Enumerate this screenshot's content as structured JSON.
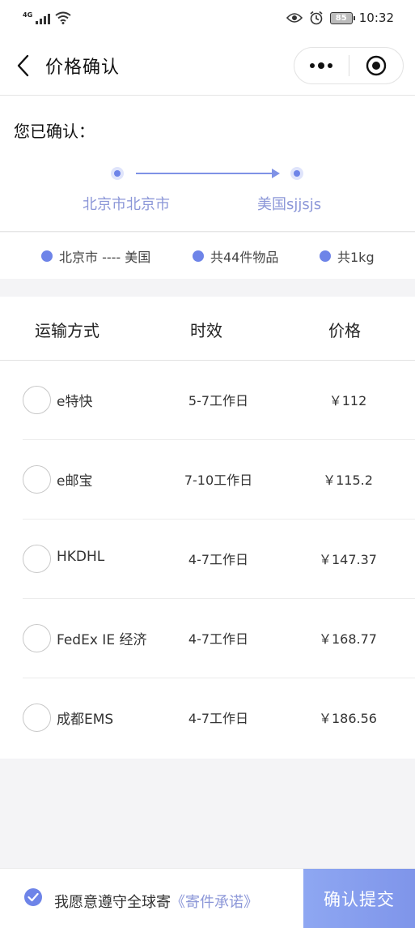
{
  "status": {
    "network": "4G",
    "battery": "85",
    "time": "10:32"
  },
  "nav": {
    "title": "价格确认"
  },
  "route": {
    "confirmed_label": "您已确认：",
    "origin": "北京市北京市",
    "destination": "美国sjjsjs"
  },
  "summary": [
    {
      "text": "北京市 ---- 美国"
    },
    {
      "text": "共44件物品"
    },
    {
      "text": "共1kg"
    }
  ],
  "table": {
    "headers": [
      "运输方式",
      "时效",
      "价格"
    ],
    "rows": [
      {
        "name": "e特快",
        "time": "5-7工作日",
        "price": "￥112"
      },
      {
        "name": "e邮宝",
        "time": "7-10工作日",
        "price": "￥115.2"
      },
      {
        "name": "HKDHL",
        "time": "4-7工作日",
        "price": "￥147.37"
      },
      {
        "name": "FedEx IE 经济",
        "time": "4-7工作日",
        "price": "￥168.77"
      },
      {
        "name": "成都EMS",
        "time": "4-7工作日",
        "price": "￥186.56"
      }
    ]
  },
  "footer": {
    "agree_prefix": "我愿意遵守全球寄",
    "agree_link": "《寄件承诺》",
    "submit_label": "确认提交"
  },
  "colors": {
    "accent": "#6e84e8",
    "accent_light": "#8c97d8",
    "submit_bg": "#8ea7f2"
  }
}
